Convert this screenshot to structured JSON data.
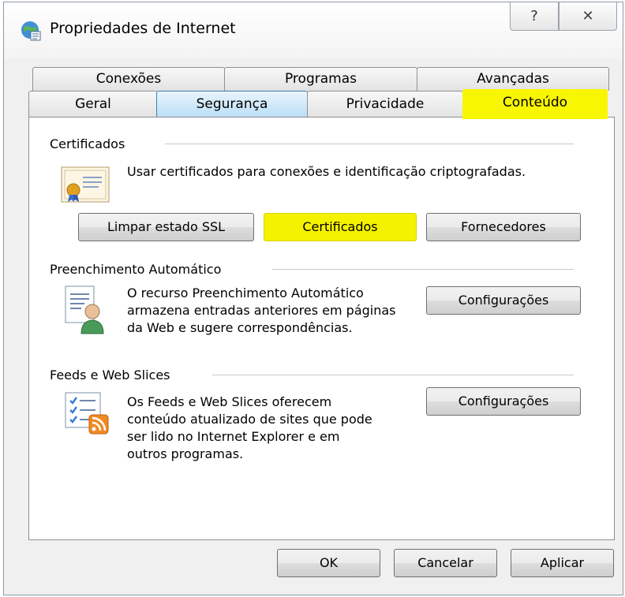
{
  "window": {
    "title": "Propriedades de Internet",
    "help_glyph": "?",
    "close_glyph": "✕"
  },
  "tabs": {
    "row1": [
      "Conexões",
      "Programas",
      "Avançadas"
    ],
    "row2": [
      "Geral",
      "Segurança",
      "Privacidade",
      "Conteúdo"
    ],
    "active": "Conteúdo",
    "hover": "Segurança"
  },
  "certificates": {
    "group_title": "Certificados",
    "description": "Usar certificados para conexões e identificação criptografadas.",
    "clear_ssl_label": "Limpar estado SSL",
    "certificates_label": "Certificados",
    "publishers_label": "Fornecedores"
  },
  "autocomplete": {
    "group_title": "Preenchimento Automático",
    "description_lines": [
      "O recurso Preenchimento Automático",
      "armazena entradas anteriores em páginas",
      "da Web e sugere correspondências."
    ],
    "settings_label": "Configurações"
  },
  "feeds": {
    "group_title": "Feeds e Web Slices",
    "description_lines": [
      "Os Feeds e Web Slices oferecem",
      "conteúdo atualizado de sites que pode",
      "ser lido no Internet Explorer e em",
      "outros programas."
    ],
    "settings_label": "Configurações"
  },
  "footer": {
    "ok_label": "OK",
    "cancel_label": "Cancelar",
    "apply_label": "Aplicar"
  },
  "colors": {
    "highlight": "#f8f600",
    "tab_hover": "#b9def6"
  }
}
